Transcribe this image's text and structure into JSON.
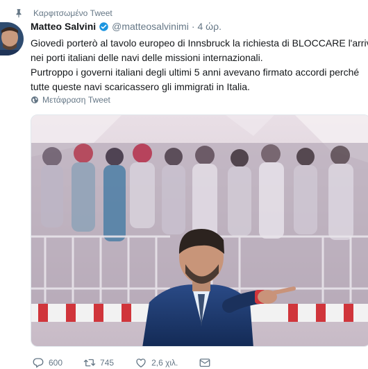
{
  "pinned": {
    "label": "Καρφιτσωμένο Tweet"
  },
  "author": {
    "name": "Matteo Salvini",
    "handle": "@matteosalvinimi",
    "time": "4 ώρ."
  },
  "tweet": {
    "lines": [
      "Giovedì porterò al tavolo europeo di Innsbruck la richiesta di BLOCCARE l'arrivo",
      "nei porti italiani delle navi delle missioni internazionali.",
      "Purtroppo i governi italiani degli ultimi 5 anni avevano firmato accordi perché",
      "tutte queste navi scaricassero gli immigrati in Italia."
    ],
    "translate_label": "Μετάφραση Tweet"
  },
  "actions": {
    "replies": "600",
    "retweets": "745",
    "likes": "2,6 χιλ."
  },
  "colors": {
    "accent": "#1b95e0",
    "muted": "#657786",
    "text": "#14171a"
  },
  "icons": [
    "pin-icon",
    "verified-icon",
    "globe-icon",
    "reply-icon",
    "retweet-icon",
    "like-icon",
    "message-icon"
  ]
}
